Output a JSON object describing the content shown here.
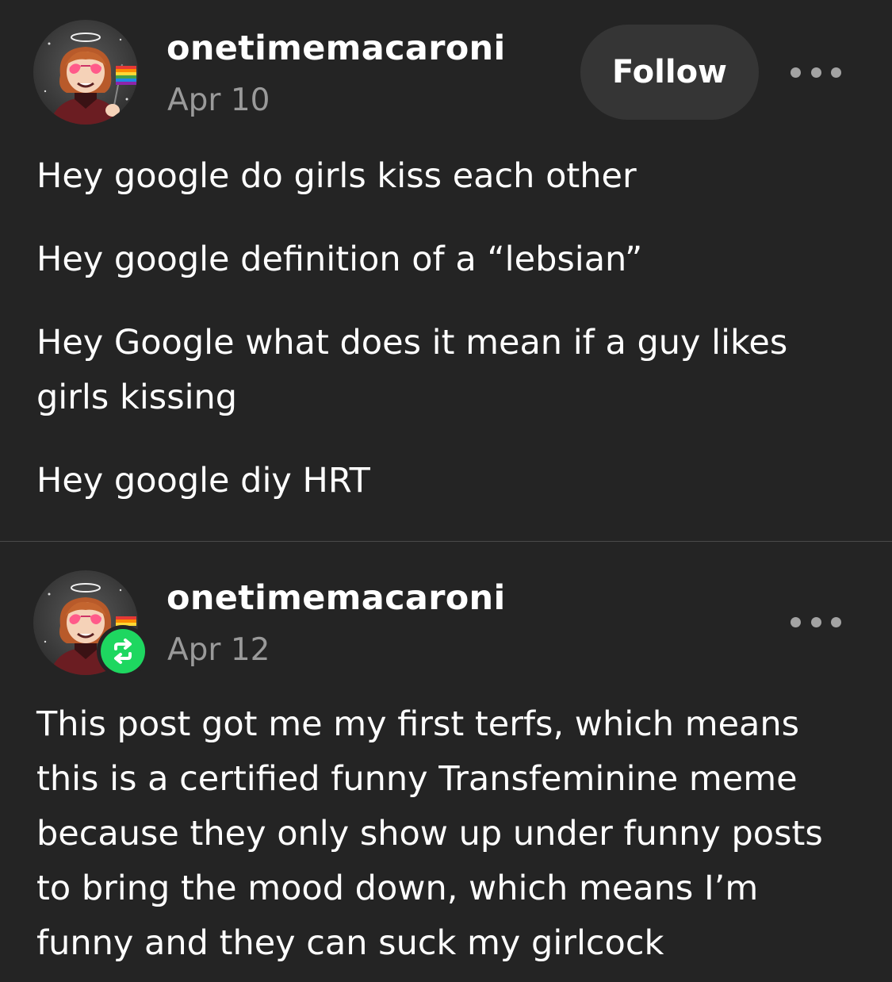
{
  "post1": {
    "username": "onetimemacaroni",
    "date": "Apr 10",
    "follow_label": "Follow",
    "paragraphs": [
      "Hey google do girls kiss each other",
      "Hey google definition of a “lebsian”",
      "Hey Google what does it mean if a guy likes girls kissing",
      "Hey google diy HRT"
    ]
  },
  "post2": {
    "username": "onetimemacaroni",
    "date": "Apr 12",
    "badge_icon": "reblog-icon",
    "paragraphs": [
      "This post got me my first terfs, which means this is a certified funny Transfeminine meme because they only show up under funny posts to bring the mood down, which means I’m funny and they can suck my girlcock"
    ]
  },
  "colors": {
    "background": "#242424",
    "text": "#ffffff",
    "muted": "#9a9a9a",
    "button": "#353535",
    "reblog_green": "#1ed760"
  }
}
